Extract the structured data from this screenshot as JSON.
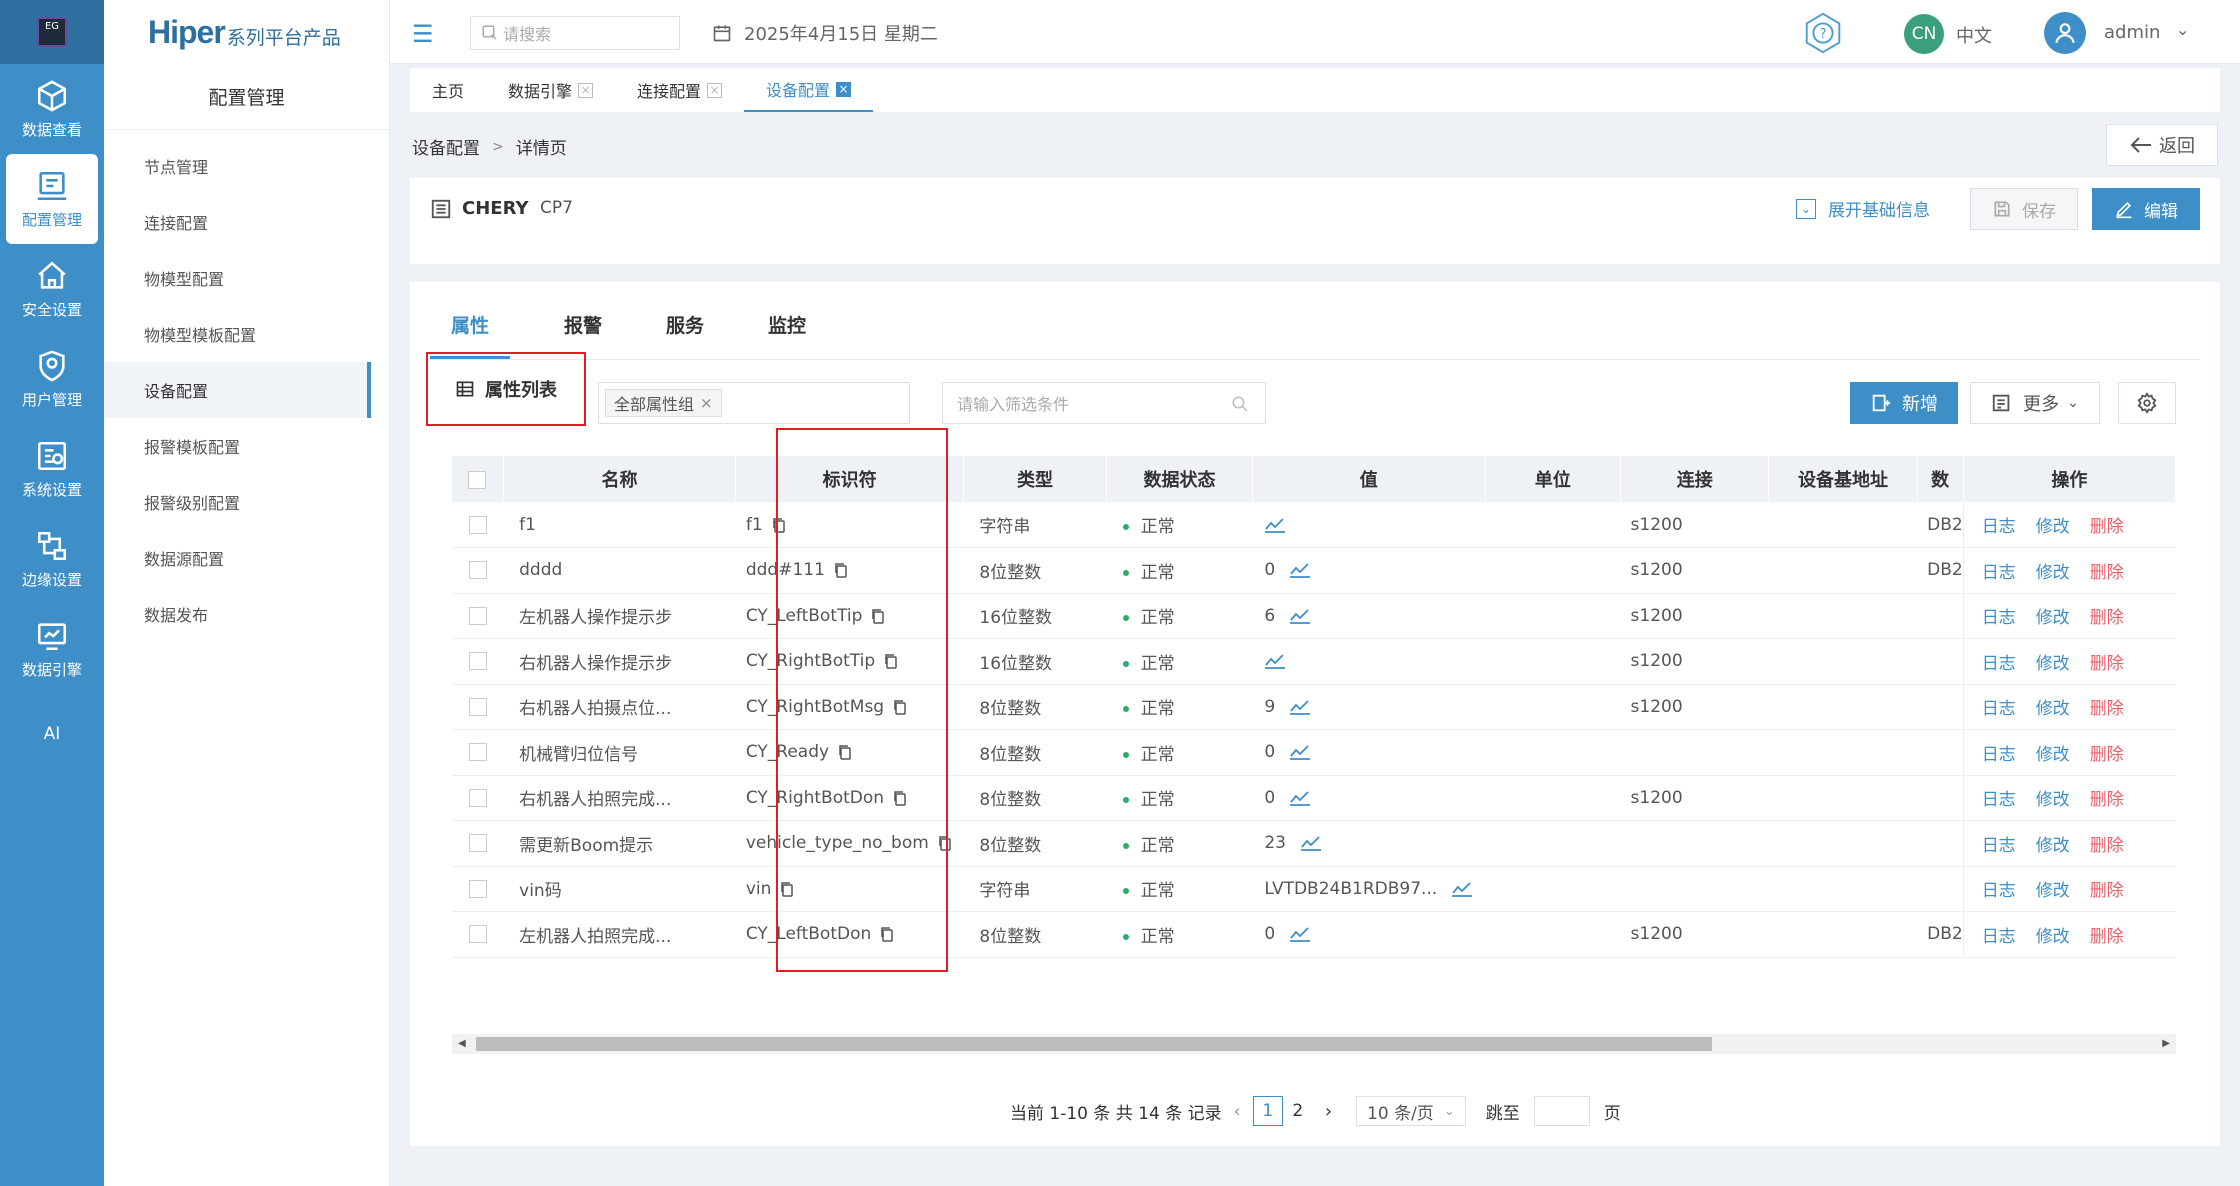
{
  "rail": {
    "logo_text": "EG",
    "items": [
      {
        "label": "数据查看",
        "icon": "cube-icon"
      },
      {
        "label": "配置管理",
        "icon": "config-icon",
        "active": true
      },
      {
        "label": "安全设置",
        "icon": "home-shield-icon"
      },
      {
        "label": "用户管理",
        "icon": "user-shield-icon"
      },
      {
        "label": "系统设置",
        "icon": "system-settings-icon"
      },
      {
        "label": "边缘设置",
        "icon": "edge-network-icon"
      },
      {
        "label": "数据引擎",
        "icon": "data-engine-icon"
      },
      {
        "label": "AI",
        "icon": ""
      }
    ]
  },
  "brand": {
    "main": "Hiper",
    "sub": "系列平台产品"
  },
  "sidebar": {
    "title": "配置管理",
    "items": [
      "节点管理",
      "连接配置",
      "物模型配置",
      "物模型模板配置",
      "设备配置",
      "报警模板配置",
      "报警级别配置",
      "数据源配置",
      "数据发布"
    ],
    "active_index": 4
  },
  "topbar": {
    "search_placeholder": "请搜索",
    "date": "2025年4月15日 星期二",
    "lang_code": "CN",
    "lang_label": "中文",
    "user": "admin"
  },
  "page_tabs": [
    {
      "label": "主页",
      "closable": false
    },
    {
      "label": "数据引擎",
      "closable": true
    },
    {
      "label": "连接配置",
      "closable": true
    },
    {
      "label": "设备配置",
      "closable": true,
      "active": true
    }
  ],
  "breadcrumb": [
    "设备配置",
    "详情页"
  ],
  "back_label": "返回",
  "device": {
    "name": "CHERY",
    "model": "CP7",
    "expand_label": "展开基础信息",
    "save_label": "保存",
    "edit_label": "编辑"
  },
  "sub_tabs": [
    "属性",
    "报警",
    "服务",
    "监控"
  ],
  "toolbar": {
    "attr_list_label": "属性列表",
    "group_tag": "全部属性组",
    "filter_placeholder": "请输入筛选条件",
    "add_label": "新增",
    "more_label": "更多"
  },
  "table": {
    "columns": [
      "名称",
      "标识符",
      "类型",
      "数据状态",
      "值",
      "单位",
      "连接",
      "设备基地址",
      "数",
      "操作"
    ],
    "ops": {
      "log": "日志",
      "edit": "修改",
      "delete": "删除"
    },
    "rows": [
      {
        "name": "f1",
        "id": "f1",
        "type": "字符串",
        "status": "正常",
        "value": "",
        "unit": "",
        "conn": "s1200",
        "db": "DB2"
      },
      {
        "name": "dddd",
        "id": "ddd#111",
        "type": "8位整数",
        "status": "正常",
        "value": "0",
        "unit": "",
        "conn": "s1200",
        "db": "DB2"
      },
      {
        "name": "左机器人操作提示步",
        "id": "CY_LeftBotTip",
        "type": "16位整数",
        "status": "正常",
        "value": "6",
        "unit": "",
        "conn": "s1200",
        "db": ""
      },
      {
        "name": "右机器人操作提示步",
        "id": "CY_RightBotTip",
        "type": "16位整数",
        "status": "正常",
        "value": "",
        "unit": "",
        "conn": "s1200",
        "db": ""
      },
      {
        "name": "右机器人拍摄点位...",
        "id": "CY_RightBotMsg",
        "type": "8位整数",
        "status": "正常",
        "value": "9",
        "unit": "",
        "conn": "s1200",
        "db": ""
      },
      {
        "name": "机械臂归位信号",
        "id": "CY_Ready",
        "type": "8位整数",
        "status": "正常",
        "value": "0",
        "unit": "",
        "conn": "",
        "db": ""
      },
      {
        "name": "右机器人拍照完成...",
        "id": "CY_RightBotDon",
        "type": "8位整数",
        "status": "正常",
        "value": "0",
        "unit": "",
        "conn": "s1200",
        "db": ""
      },
      {
        "name": "需更新Boom提示",
        "id": "vehicle_type_no_bom",
        "type": "8位整数",
        "status": "正常",
        "value": "23",
        "unit": "",
        "conn": "",
        "db": ""
      },
      {
        "name": "vin码",
        "id": "vin",
        "type": "字符串",
        "status": "正常",
        "value": "LVTDB24B1RDB97...",
        "unit": "",
        "conn": "",
        "db": ""
      },
      {
        "name": "左机器人拍照完成...",
        "id": "CY_LeftBotDon",
        "type": "8位整数",
        "status": "正常",
        "value": "0",
        "unit": "",
        "conn": "s1200",
        "db": "DB2"
      }
    ]
  },
  "pagination": {
    "summary": "当前 1-10 条 共 14 条 记录",
    "pages": [
      "1",
      "2"
    ],
    "current": "1",
    "page_size": "10 条/页",
    "jump_label": "跳至",
    "page_suffix": "页"
  }
}
